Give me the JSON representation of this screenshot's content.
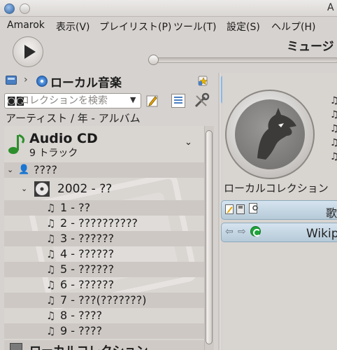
{
  "window": {
    "title": "A"
  },
  "menu": [
    "Amarok",
    "表示(V)",
    "プレイリスト(P)",
    "ツール(T)",
    "設定(S)",
    "ヘルプ(H)"
  ],
  "toolbar": {
    "now_playing": "ミュージ",
    "progress": 0.0
  },
  "browser": {
    "breadcrumb_title": "ローカル音楽",
    "breadcrumb_separator": "›",
    "search_placeholder": "コレクションを検索",
    "grouping": "アーティスト / 年 - アルバム"
  },
  "tree": {
    "root": {
      "title": "Audio CD",
      "subtitle": "9 トラック"
    },
    "artist": "????",
    "album": "2002 - ??",
    "tracks": [
      "1 - ??",
      "2 - ??????????",
      "3 - ??????",
      "4 - ??????",
      "5 - ??????",
      "6 - ??????",
      "7 - ???(???????)",
      "8 - ????",
      "9 - ????"
    ],
    "next_collection": "ローカルコレクション"
  },
  "context": {
    "collection_label": "ローカルコレクション",
    "lyrics_title": "歌",
    "wiki_title": "Wikip"
  },
  "icons": {
    "app": "amarok-icon",
    "cd": "audio-cd-icon",
    "note": "music-note-icon",
    "artist": "artist-icon"
  },
  "colors": {
    "accent": "#4a7fc1",
    "applet_bar": "#c5d7e4"
  }
}
